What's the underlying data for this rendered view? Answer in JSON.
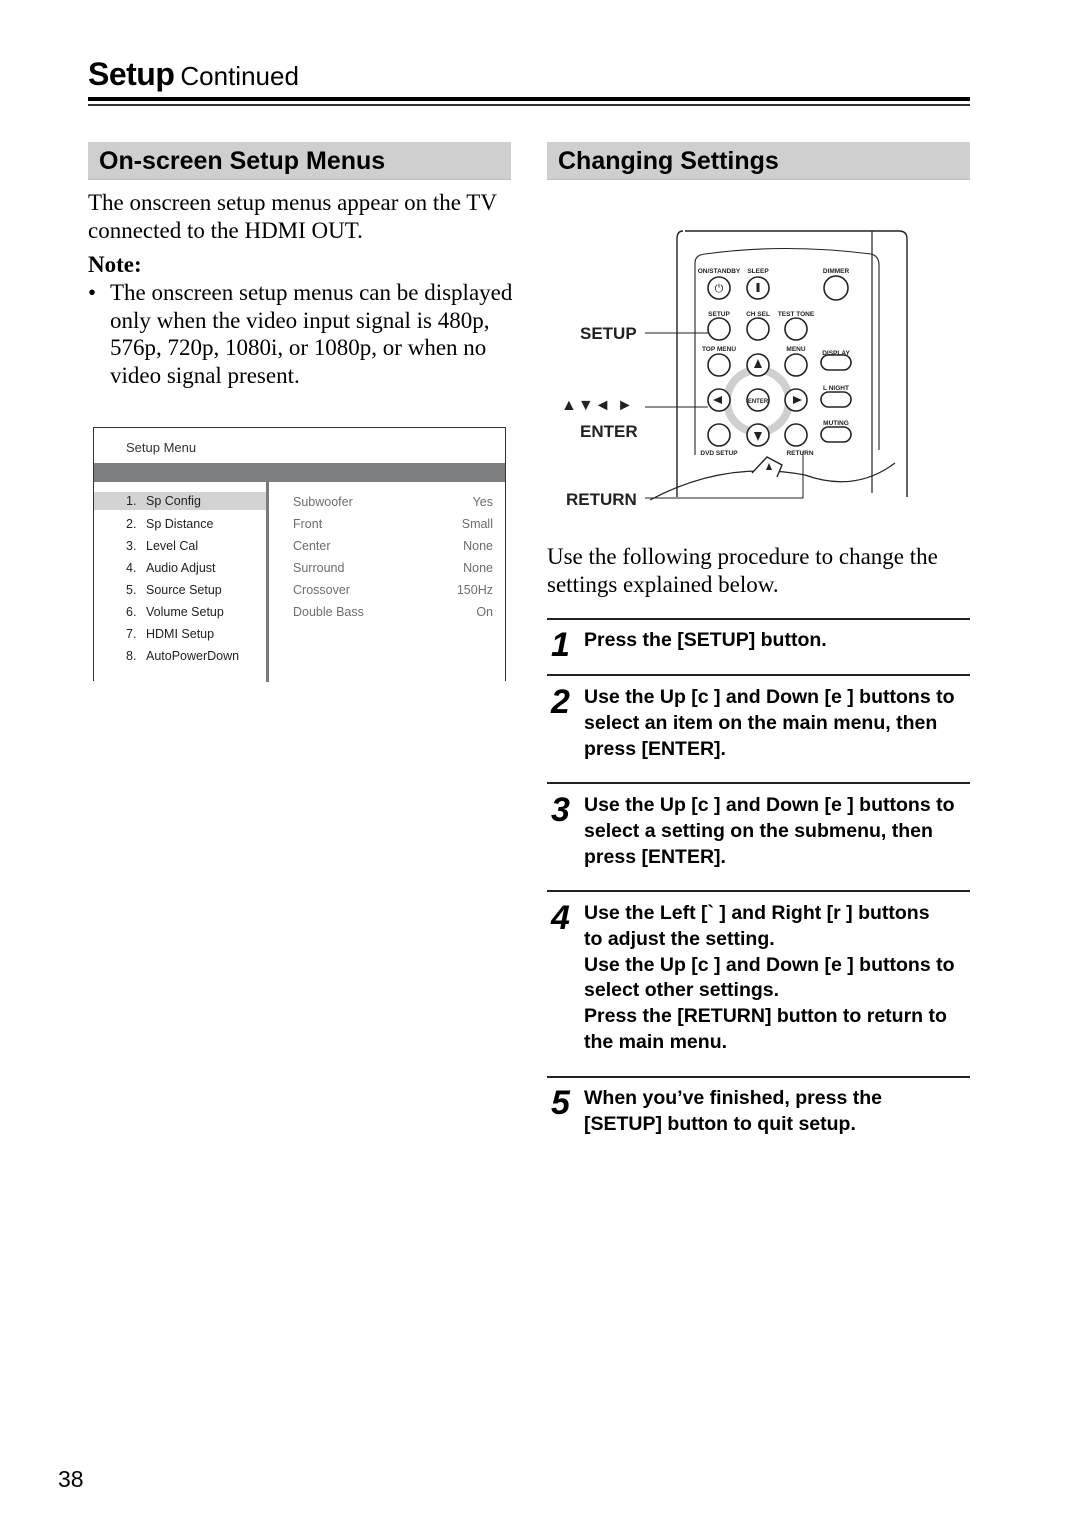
{
  "header": {
    "title_bold": "Setup",
    "title_regular": "Continued"
  },
  "left_section": {
    "heading": "On-screen Setup Menus",
    "intro_lines": [
      "The onscreen setup menus appear on the TV",
      "connected to the HDMI OUT."
    ],
    "note_label": "Note:",
    "note_bullet": "•",
    "note_lines": [
      "The onscreen setup menus can be displayed",
      "only when the video input signal is 480p,",
      "576p, 720p, 1080i, or 1080p, or when no",
      "video signal present."
    ],
    "setup_menu": {
      "title": "Setup Menu",
      "main_items": [
        {
          "num": "1.",
          "label": "Sp Config",
          "selected": true
        },
        {
          "num": "2.",
          "label": "Sp Distance",
          "selected": false
        },
        {
          "num": "3.",
          "label": "Level Cal",
          "selected": false
        },
        {
          "num": "4.",
          "label": "Audio Adjust",
          "selected": false
        },
        {
          "num": "5.",
          "label": "Source Setup",
          "selected": false
        },
        {
          "num": "6.",
          "label": "Volume Setup",
          "selected": false
        },
        {
          "num": "7.",
          "label": "HDMI Setup",
          "selected": false
        },
        {
          "num": "8.",
          "label": "AutoPowerDown",
          "selected": false
        }
      ],
      "sub_items": [
        {
          "key": "Subwoofer",
          "value": "Yes"
        },
        {
          "key": "Front",
          "value": "Small"
        },
        {
          "key": "Center",
          "value": "None"
        },
        {
          "key": "Surround",
          "value": "None"
        },
        {
          "key": "Crossover",
          "value": "150Hz"
        },
        {
          "key": "Double Bass",
          "value": "On"
        }
      ]
    }
  },
  "right_section": {
    "heading": "Changing Settings",
    "remote": {
      "callouts": {
        "setup": "SETUP",
        "arrows": "▲▼◄ ►",
        "enter": "ENTER",
        "return": "RETURN"
      },
      "button_labels": {
        "on_standby": "ON/STANDBY",
        "sleep": "SLEEP",
        "dimmer": "DIMMER",
        "setup": "SETUP",
        "ch_sel": "CH SEL",
        "test_tone": "TEST TONE",
        "top_menu": "TOP MENU",
        "menu": "MENU",
        "display": "DISPLAY",
        "l_night": "L NIGHT",
        "enter": "ENTER",
        "muting": "MUTING",
        "dvd_setup": "DVD SETUP",
        "return": "RETURN"
      }
    },
    "procedure_intro_lines": [
      "Use the following procedure to change the",
      "settings explained below."
    ],
    "steps": [
      {
        "number": "1",
        "lines": [
          "Press the [SETUP] button."
        ]
      },
      {
        "number": "2",
        "lines": [
          "Use the Up [c ] and Down [e ] buttons to",
          "select an item on the main menu, then",
          "press [ENTER]."
        ]
      },
      {
        "number": "3",
        "lines": [
          "Use the Up [c ] and Down [e ] buttons to",
          "select a setting on the submenu, then",
          "press [ENTER]."
        ]
      },
      {
        "number": "4",
        "lines": [
          "Use the Left [`  ] and Right [r  ] buttons",
          "to adjust the setting.",
          "Use the Up [c ] and Down [e ] buttons to",
          "select other settings.",
          "Press the [RETURN] button to return to",
          "the main menu."
        ]
      },
      {
        "number": "5",
        "lines": [
          "When you’ve finished, press the",
          "[SETUP] button to quit setup."
        ]
      }
    ]
  },
  "page_number": "38"
}
